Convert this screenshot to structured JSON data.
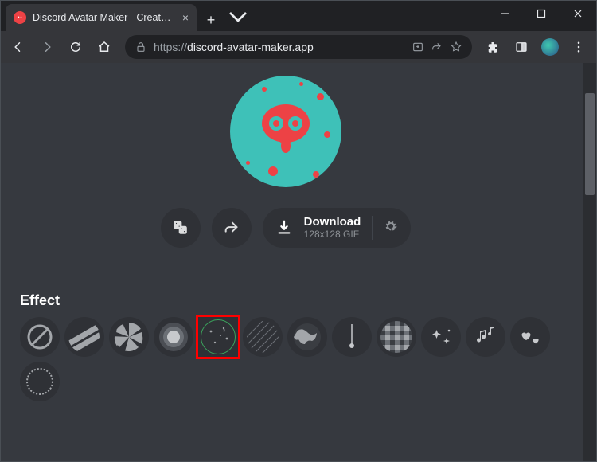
{
  "window": {
    "tab_title": "Discord Avatar Maker - Create yo",
    "url_protocol": "https://",
    "url_host": "discord-avatar-maker.app"
  },
  "actions": {
    "download_label": "Download",
    "download_size": "128x128 GIF"
  },
  "section": {
    "title": "Effect"
  },
  "effects": [
    {
      "id": "none",
      "selected": false
    },
    {
      "id": "stripes",
      "selected": false
    },
    {
      "id": "segments",
      "selected": false
    },
    {
      "id": "radial",
      "selected": false
    },
    {
      "id": "sparkle-dots",
      "selected": true
    },
    {
      "id": "scratch",
      "selected": false
    },
    {
      "id": "globe",
      "selected": false
    },
    {
      "id": "pendulum",
      "selected": false
    },
    {
      "id": "plaid",
      "selected": false
    },
    {
      "id": "sparkle-stars",
      "selected": false
    },
    {
      "id": "music-notes",
      "selected": false
    },
    {
      "id": "hearts",
      "selected": false
    },
    {
      "id": "stamp",
      "selected": false
    }
  ]
}
